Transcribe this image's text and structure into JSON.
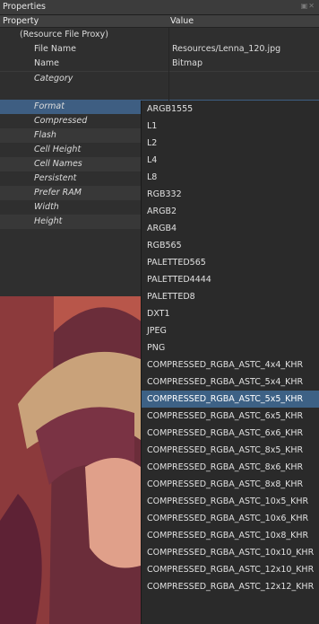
{
  "window": {
    "title": "Properties"
  },
  "columns": {
    "property": "Property",
    "value": "Value"
  },
  "rows": [
    {
      "name": "(Resource File Proxy)",
      "value": ""
    },
    {
      "name": "File Name",
      "value": "Resources/Lenna_120.jpg"
    },
    {
      "name": "Name",
      "value": "Bitmap"
    },
    {
      "name": "Category",
      "value": ""
    },
    {
      "name": "Format",
      "value": ""
    },
    {
      "name": "Compressed",
      "value": ""
    },
    {
      "name": "Flash",
      "value": ""
    },
    {
      "name": "Cell Height",
      "value": ""
    },
    {
      "name": "Cell Names",
      "value": ""
    },
    {
      "name": "Persistent",
      "value": ""
    },
    {
      "name": "Prefer RAM",
      "value": ""
    },
    {
      "name": "Width",
      "value": ""
    },
    {
      "name": "Height",
      "value": ""
    }
  ],
  "dropdown": {
    "selected": "COMPRESSED_RGBA_ASTC_5x5_KHR",
    "options": [
      "ARGB1555",
      "L1",
      "L2",
      "L4",
      "L8",
      "RGB332",
      "ARGB2",
      "ARGB4",
      "RGB565",
      "PALETTED565",
      "PALETTED4444",
      "PALETTED8",
      "DXT1",
      "JPEG",
      "PNG",
      "COMPRESSED_RGBA_ASTC_4x4_KHR",
      "COMPRESSED_RGBA_ASTC_5x4_KHR",
      "COMPRESSED_RGBA_ASTC_5x5_KHR",
      "COMPRESSED_RGBA_ASTC_6x5_KHR",
      "COMPRESSED_RGBA_ASTC_6x6_KHR",
      "COMPRESSED_RGBA_ASTC_8x5_KHR",
      "COMPRESSED_RGBA_ASTC_8x6_KHR",
      "COMPRESSED_RGBA_ASTC_8x8_KHR",
      "COMPRESSED_RGBA_ASTC_10x5_KHR",
      "COMPRESSED_RGBA_ASTC_10x6_KHR",
      "COMPRESSED_RGBA_ASTC_10x8_KHR",
      "COMPRESSED_RGBA_ASTC_10x10_KHR",
      "COMPRESSED_RGBA_ASTC_12x10_KHR",
      "COMPRESSED_RGBA_ASTC_12x12_KHR"
    ]
  },
  "colors": {
    "selection": "#3d6185",
    "panel": "#2f2f2f",
    "text": "#dcdcdc"
  },
  "icons": {
    "window_controls": "dock-close-icon"
  }
}
